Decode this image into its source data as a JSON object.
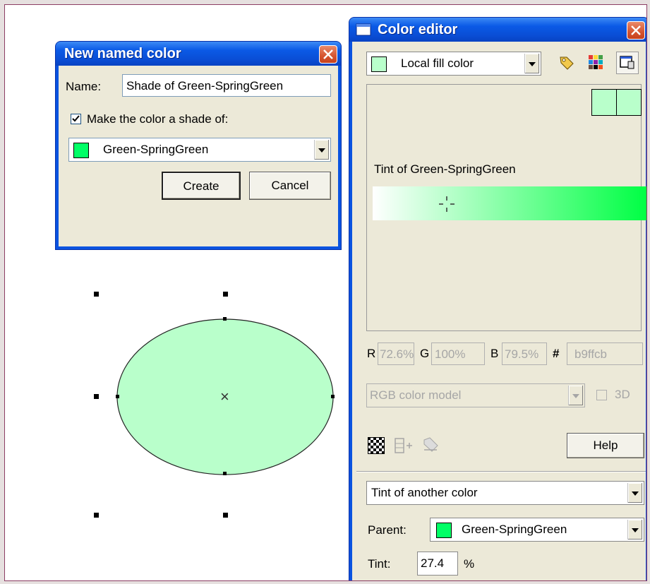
{
  "new_color_dialog": {
    "title": "New named color",
    "name_label": "Name:",
    "name_value": "Shade of Green-SpringGreen",
    "shade_checkbox_label": "Make the color a shade of:",
    "shade_checked": true,
    "parent_color_value": "Green-SpringGreen",
    "parent_color_swatch": "#00ff66",
    "create_label": "Create",
    "cancel_label": "Cancel"
  },
  "canvas": {
    "ellipse_fill": "#b9ffcb",
    "center_marker": "×"
  },
  "color_editor": {
    "title": "Color editor",
    "target_value": "Local fill color",
    "target_swatch": "#b9ffcb",
    "tint_label": "Tint of Green-SpringGreen",
    "gradient_start": "#ffffff",
    "gradient_end": "#00ff44",
    "picker_position": 0.27,
    "r_label": "R",
    "r_value": "72.6%",
    "g_label": "G",
    "g_value": "100%",
    "b_label": "B",
    "b_value": "79.5%",
    "hex_label": "#",
    "hex_value": "b9ffcb",
    "color_model_value": "RGB color model",
    "three_d_label": "3D",
    "help_label": "Help",
    "mode_value": "Tint of another color",
    "parent_label": "Parent:",
    "parent_value": "Green-SpringGreen",
    "parent_swatch": "#00ff66",
    "tint_field_label": "Tint:",
    "tint_value": "27.4",
    "tint_unit": "%",
    "icons": [
      "tag-icon",
      "palette-icon",
      "window-icon",
      "checkerboard-icon",
      "add-swatch-icon",
      "apply-tag-icon"
    ]
  }
}
